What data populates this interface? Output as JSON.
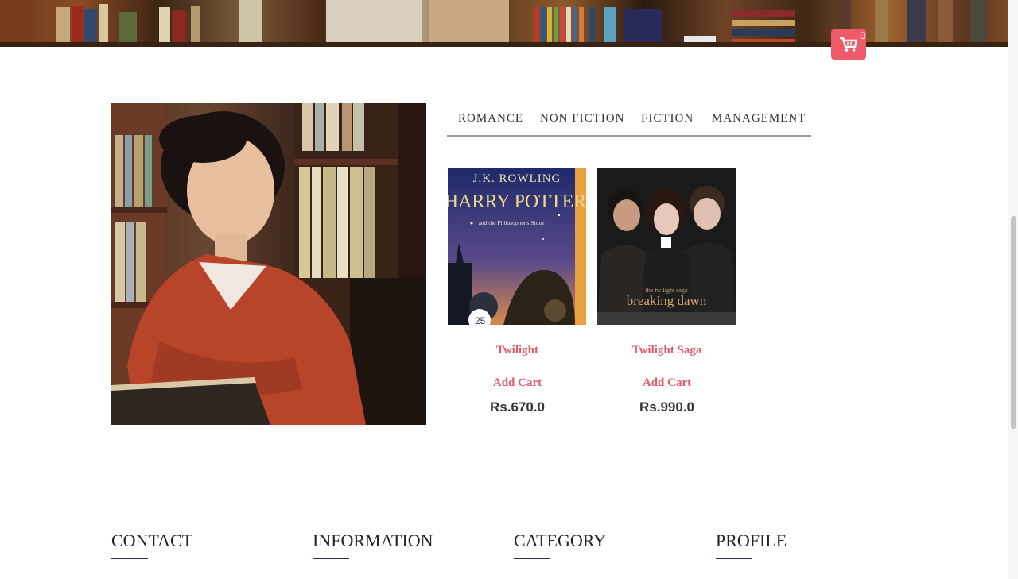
{
  "header": {
    "cart_icon": "cart-icon",
    "cart_count": "0",
    "accent_color": "#ef5a6b"
  },
  "tabs": [
    {
      "label": "ROMANCE"
    },
    {
      "label": "NON FICTION"
    },
    {
      "label": "FICTION"
    },
    {
      "label": "MANAGEMENT"
    }
  ],
  "products": [
    {
      "cover_author": "J.K. ROWLING",
      "cover_title": "HARRY POTTER",
      "cover_subtitle": "and the Philosopher's Stone",
      "title": "Twilight",
      "add_label": "Add Cart",
      "price": "Rs.670.0"
    },
    {
      "cover_title_small": "the twilight saga",
      "cover_title": "breaking dawn",
      "title": "Twilight Saga",
      "add_label": "Add Cart",
      "price": "Rs.990.0"
    }
  ],
  "footer": {
    "headings": [
      "CONTACT",
      "INFORMATION",
      "CATEGORY",
      "PROFILE"
    ],
    "underline_color": "#2b2f5e"
  },
  "colors": {
    "title_pink": "#e05a6a",
    "text_dark": "#333333"
  }
}
